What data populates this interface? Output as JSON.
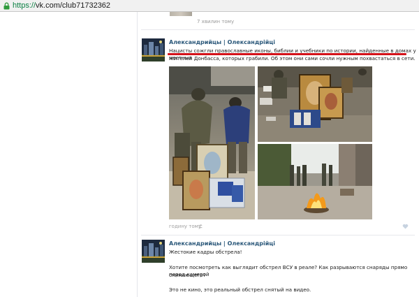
{
  "browser": {
    "url_scheme": "https://",
    "url_rest": "vk.com/club71732362"
  },
  "prev_post": {
    "time": "7 хвилин тому"
  },
  "posts": [
    {
      "author": "Александрийцы | Олександрійці",
      "text_line1": "Нацисты сожгли православные иконы, библии и учебники по истории, найденные в домах у местных",
      "text_line2": "жителей Донбасса, которых грабили. Об этом они сами сочли нужным похвастаться в сети.",
      "time": "годину тому"
    },
    {
      "author": "Александрийцы | Олександрійці",
      "text_line1": "Жестокие кадры обстрела!",
      "text_line2": "Хотите посмотреть как выглядит обстрел ВСУ в реале? Как разрываются снаряды прямо перед камерой",
      "text_line3": "снимающего?",
      "text_line4": "Это не кино, это реальный обстрел снятый на видео."
    }
  ],
  "colors": {
    "author_link": "#2b587a",
    "highlight_underline": "#d4121a"
  }
}
